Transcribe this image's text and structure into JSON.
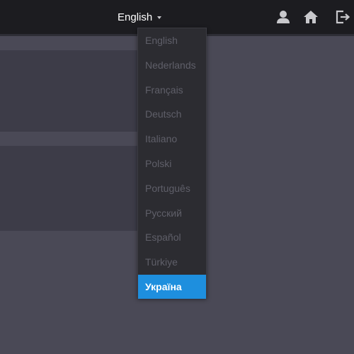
{
  "header": {
    "language_label": "English",
    "icons": {
      "user": "user-icon",
      "home": "home-icon",
      "logout": "logout-icon"
    }
  },
  "language_menu": {
    "items": [
      {
        "label": "English"
      },
      {
        "label": "Nederlands"
      },
      {
        "label": "Français"
      },
      {
        "label": "Deutsch"
      },
      {
        "label": "Italiano"
      },
      {
        "label": "Polski"
      },
      {
        "label": "Português"
      },
      {
        "label": "Русский"
      },
      {
        "label": "Español"
      },
      {
        "label": "Türkiye"
      },
      {
        "label": "Україна"
      }
    ],
    "selected_label": "Україна"
  },
  "colors": {
    "topbar": "#1c1c20",
    "background": "#4a4956",
    "menu_background": "#2c2c31",
    "menu_text": "#5f5f69",
    "highlight": "#1e8fde"
  }
}
